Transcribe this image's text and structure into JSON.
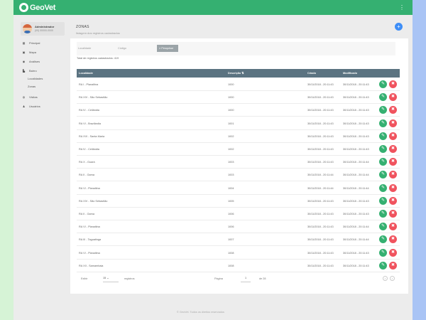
{
  "app": {
    "logo_text": "GeoVet",
    "menu_icon": "kebab-menu-icon"
  },
  "user": {
    "name": "Administrador",
    "phone": "(00) 00000-0000"
  },
  "sidebar": {
    "items": [
      {
        "label": "Principal",
        "icon": "grid-icon"
      },
      {
        "label": "Mapa",
        "icon": "map-icon"
      },
      {
        "label": "Análises",
        "icon": "analytics-icon"
      },
      {
        "label": "Bairro",
        "icon": "building-icon"
      },
      {
        "label": "Visitas",
        "icon": "globe-icon"
      },
      {
        "label": "Usuários",
        "icon": "users-icon"
      }
    ],
    "subitems": [
      {
        "label": "Localidades"
      },
      {
        "label": "Zonas"
      }
    ]
  },
  "page": {
    "title": "ZONAS",
    "subtitle": "listagem dos registros cadastrados"
  },
  "filters": {
    "localidade_label": "Localidade",
    "codigo_label": "Código",
    "search_label": "Pesquisar",
    "total_text": "Total de registros cadastrados: 419"
  },
  "table": {
    "headers": {
      "localidade": "Localidade",
      "descricao": "Descrição",
      "criado": "Criado",
      "modificado": "Modificado"
    },
    "rows": [
      {
        "localidade": "RA I - Planaltina",
        "descricao": "1000",
        "criado": "30/11/2018 - 20:11:43",
        "modificado": "30/11/2018 - 20:11:43"
      },
      {
        "localidade": "RA XIV - São Sebastião",
        "descricao": "1000",
        "criado": "30/11/2018 - 20:11:43",
        "modificado": "30/11/2018 - 20:11:43"
      },
      {
        "localidade": "RA IV - Ceilândia",
        "descricao": "1000",
        "criado": "30/11/2018 - 20:11:43",
        "modificado": "30/11/2018 - 20:11:43"
      },
      {
        "localidade": "RA VI - Brazlândia",
        "descricao": "1001",
        "criado": "30/11/2018 - 20:11:43",
        "modificado": "30/11/2018 - 20:11:43"
      },
      {
        "localidade": "RA XVI - Santa Maria",
        "descricao": "1002",
        "criado": "30/11/2018 - 20:11:43",
        "modificado": "30/11/2018 - 20:11:43"
      },
      {
        "localidade": "RA IV - Ceilândia",
        "descricao": "1002",
        "criado": "30/11/2018 - 20:11:43",
        "modificado": "30/11/2018 - 20:11:43"
      },
      {
        "localidade": "RA X - Guará",
        "descricao": "1003",
        "criado": "30/11/2018 - 20:11:43",
        "modificado": "30/11/2018 - 20:11:44"
      },
      {
        "localidade": "RA II - Gama",
        "descricao": "1003",
        "criado": "30/11/2018 - 20:11:44",
        "modificado": "30/11/2018 - 20:11:44"
      },
      {
        "localidade": "RA VI - Planaltina",
        "descricao": "1004",
        "criado": "30/11/2018 - 20:11:44",
        "modificado": "30/11/2018 - 20:11:44"
      },
      {
        "localidade": "RA XIV - São Sebastião",
        "descricao": "1005",
        "criado": "30/11/2018 - 20:11:43",
        "modificado": "30/11/2018 - 20:11:43"
      },
      {
        "localidade": "RA II - Gama",
        "descricao": "1006",
        "criado": "30/11/2018 - 20:11:43",
        "modificado": "30/11/2018 - 20:11:43"
      },
      {
        "localidade": "RA VI - Planaltina",
        "descricao": "1006",
        "criado": "30/11/2018 - 20:11:43",
        "modificado": "30/11/2018 - 20:11:44"
      },
      {
        "localidade": "RA III - Taguatinga",
        "descricao": "1007",
        "criado": "30/11/2018 - 20:11:43",
        "modificado": "30/11/2018 - 20:11:44"
      },
      {
        "localidade": "RA VI - Planaltina",
        "descricao": "1008",
        "criado": "30/11/2018 - 20:11:43",
        "modificado": "30/11/2018 - 20:11:43"
      },
      {
        "localidade": "RA XII - Samambaia",
        "descricao": "1008",
        "criado": "30/11/2018 - 20:11:43",
        "modificado": "30/11/2018 - 20:11:43"
      }
    ]
  },
  "footer": {
    "exibir_label": "Exibir",
    "page_size": "15",
    "registros_label": "registros",
    "pagina_label": "Página",
    "current_page": "1",
    "of_pages": "de 28",
    "prev_symbol": "‹",
    "next_symbol": "›"
  },
  "copyright": "© GeoVet. Todos os direitos reservados",
  "colors": {
    "brand_green": "#35b071",
    "header_slate": "#5b7381",
    "fab_blue": "#3e8ef7",
    "delete_red": "#f0535e"
  }
}
